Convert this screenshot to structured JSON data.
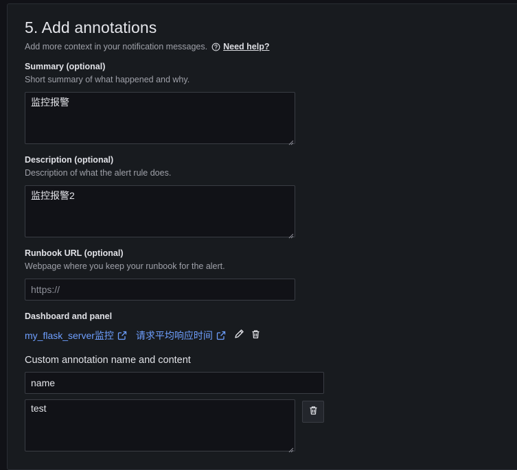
{
  "section": {
    "title": "5. Add annotations",
    "subtitle": "Add more context in your notification messages.",
    "help_link": "Need help?"
  },
  "summary": {
    "label": "Summary (optional)",
    "description": "Short summary of what happened and why.",
    "value": "监控报警"
  },
  "description_field": {
    "label": "Description (optional)",
    "description": "Description of what the alert rule does.",
    "value": "监控报警2"
  },
  "runbook": {
    "label": "Runbook URL (optional)",
    "description": "Webpage where you keep your runbook for the alert.",
    "placeholder": "https://",
    "value": ""
  },
  "dashboard": {
    "label": "Dashboard and panel",
    "dashboard_link": "my_flask_server监控",
    "panel_link": "请求平均响应时间"
  },
  "custom": {
    "label": "Custom annotation name and content",
    "name_value": "name",
    "content_value": "test"
  },
  "colors": {
    "background": "#111217",
    "card": "#181b1f",
    "link": "#6e9fff",
    "border": "#3a3d44"
  },
  "icons": [
    "help-circle-icon",
    "external-link-icon",
    "pen-icon",
    "trash-icon",
    "resize-grip-icon"
  ]
}
